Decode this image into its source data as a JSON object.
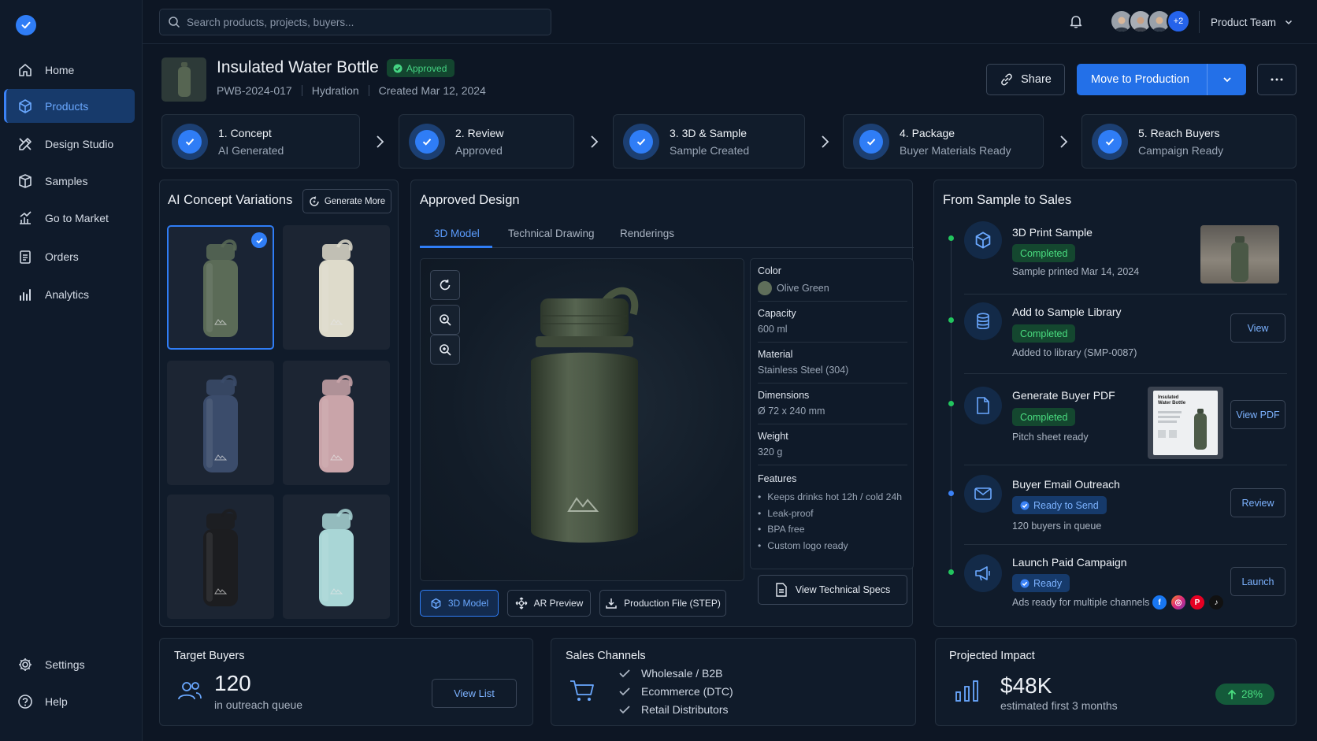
{
  "search": {
    "placeholder": "Search products, projects, buyers..."
  },
  "team": {
    "name": "Product Team",
    "extra_members": "+2"
  },
  "nav": [
    {
      "label": "Home",
      "icon": "home-icon"
    },
    {
      "label": "Products",
      "icon": "cube-icon"
    },
    {
      "label": "Design Studio",
      "icon": "design-tools-icon"
    },
    {
      "label": "Samples",
      "icon": "box-icon"
    },
    {
      "label": "Go to Market",
      "icon": "chart-growth-icon"
    },
    {
      "label": "Orders",
      "icon": "clipboard-icon"
    },
    {
      "label": "Analytics",
      "icon": "bar-chart-icon"
    }
  ],
  "nav_bottom": [
    {
      "label": "Settings",
      "icon": "gear-icon"
    },
    {
      "label": "Help",
      "icon": "help-icon"
    }
  ],
  "product": {
    "title": "Insulated Water Bottle",
    "status": "Approved",
    "sku": "PWB-2024-017",
    "category": "Hydration",
    "created": "Created Mar 12, 2024"
  },
  "actions": {
    "share": "Share",
    "move": "Move to Production"
  },
  "steps": [
    {
      "title": "1. Concept",
      "sub": "AI Generated"
    },
    {
      "title": "2. Review",
      "sub": "Approved"
    },
    {
      "title": "3. 3D & Sample",
      "sub": "Sample Created"
    },
    {
      "title": "4. Package",
      "sub": "Buyer Materials Ready"
    },
    {
      "title": "5. Reach Buyers",
      "sub": "Campaign Ready"
    }
  ],
  "variations": {
    "title": "AI Concept Variations",
    "generate": "Generate More",
    "colors": [
      "#5b6b57",
      "#dedbcb",
      "#3b4c6b",
      "#c9a4a9",
      "#1c1d20",
      "#a9d6d6"
    ]
  },
  "design": {
    "title": "Approved Design",
    "tabs": [
      "3D Model",
      "Technical Drawing",
      "Renderings"
    ],
    "bottom_buttons": [
      "3D Model",
      "AR Preview",
      "Production File (STEP)"
    ],
    "tech_specs": "View Technical Specs"
  },
  "specs": {
    "color_label": "Color",
    "color_value": "Olive Green",
    "capacity_label": "Capacity",
    "capacity_value": "600 ml",
    "material_label": "Material",
    "material_value": "Stainless Steel (304)",
    "dimensions_label": "Dimensions",
    "dimensions_value": "Ø 72 x 240 mm",
    "weight_label": "Weight",
    "weight_value": "320 g",
    "features_label": "Features",
    "features": [
      "Keeps drinks hot 12h / cold 24h",
      "Leak-proof",
      "BPA free",
      "Custom logo ready"
    ]
  },
  "sales": {
    "title": "From Sample to Sales",
    "items": [
      {
        "title": "3D Print Sample",
        "badge": "Completed",
        "sub": "Sample printed Mar 14, 2024",
        "button": ""
      },
      {
        "title": "Add to Sample Library",
        "badge": "Completed",
        "sub": "Added to library (SMP-0087)",
        "button": "View"
      },
      {
        "title": "Generate Buyer PDF",
        "badge": "Completed",
        "sub": "Pitch sheet ready",
        "button": "View PDF"
      },
      {
        "title": "Buyer Email Outreach",
        "badge": "Ready to Send",
        "sub": "120 buyers in queue",
        "button": "Review"
      },
      {
        "title": "Launch Paid Campaign",
        "badge": "Ready",
        "sub": "Ads ready for multiple channels",
        "button": "Launch"
      }
    ],
    "pdf_thumb_title": "Insulated Water Bottle"
  },
  "target_buyers": {
    "title": "Target Buyers",
    "count": "120",
    "sub": "in outreach queue",
    "button": "View List"
  },
  "channels": {
    "title": "Sales Channels",
    "items": [
      "Wholesale / B2B",
      "Ecommerce (DTC)",
      "Retail Distributors"
    ]
  },
  "impact": {
    "title": "Projected Impact",
    "value": "$48K",
    "sub": "estimated first 3 months",
    "growth": "28%"
  }
}
